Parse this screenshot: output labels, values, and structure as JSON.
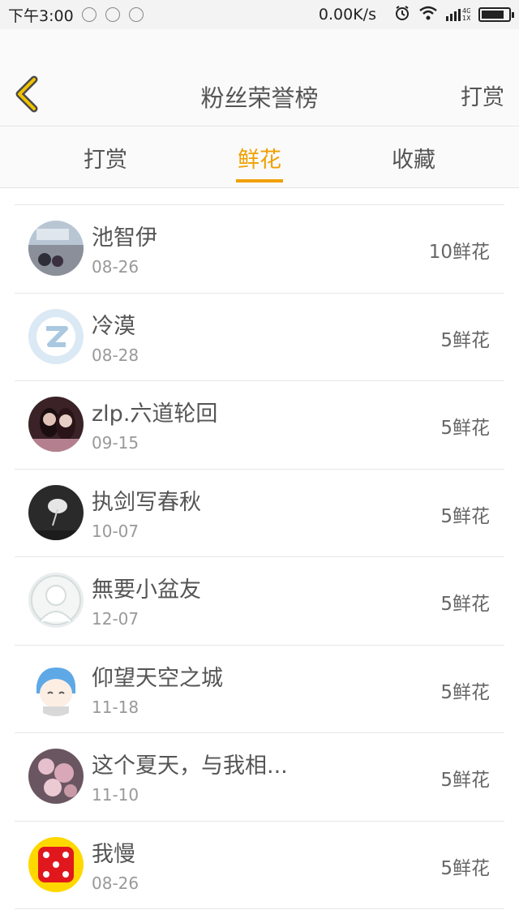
{
  "status_bar": {
    "time": "下午3:00",
    "network_speed": "0.00K/s",
    "network_type": "4G",
    "signal_sub": "1X",
    "battery_level": 0.85
  },
  "header": {
    "title": "粉丝荣誉榜",
    "right_action": "打赏",
    "back_icon": "chevron-left-icon"
  },
  "tabs": [
    {
      "label": "打赏",
      "active": false
    },
    {
      "label": "鲜花",
      "active": true
    },
    {
      "label": "收藏",
      "active": false
    }
  ],
  "colors": {
    "accent": "#f0a000",
    "text": "#555555",
    "secondary_text": "#999999",
    "divider": "#e6e6e6"
  },
  "fans": [
    {
      "name": "池智伊",
      "date": "08-26",
      "amount": "10鲜花",
      "avatar": "photo-avatar"
    },
    {
      "name": "冷漠",
      "date": "08-28",
      "amount": "5鲜花",
      "avatar": "qq-default-avatar"
    },
    {
      "name": "zlp.六道轮回",
      "date": "09-15",
      "amount": "5鲜花",
      "avatar": "photo-avatar"
    },
    {
      "name": "执剑写春秋",
      "date": "10-07",
      "amount": "5鲜花",
      "avatar": "photo-avatar"
    },
    {
      "name": "無要小盆友",
      "date": "12-07",
      "amount": "5鲜花",
      "avatar": "default-avatar"
    },
    {
      "name": "仰望天空之城",
      "date": "11-18",
      "amount": "5鲜花",
      "avatar": "cartoon-avatar"
    },
    {
      "name": "这个夏天，与我相...",
      "date": "11-10",
      "amount": "5鲜花",
      "avatar": "photo-avatar"
    },
    {
      "name": "我慢",
      "date": "08-26",
      "amount": "5鲜花",
      "avatar": "dice-avatar"
    }
  ]
}
